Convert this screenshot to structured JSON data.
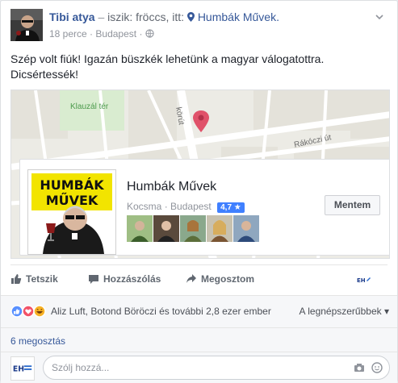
{
  "header": {
    "author": "Tibi atya",
    "dash": "–",
    "activity": "iszik: fröccs, itt:",
    "place": "Humbák Művek.",
    "time": "18 perce",
    "location": "Budapest",
    "sep": "·"
  },
  "post_text": "Szép volt fiúk! Igazán büszkék lehetünk a magyar válogatottra. Dicsértessék!",
  "map": {
    "labels": {
      "park": "Klauzál tér",
      "street1": "körút",
      "street2": "Rákóczi út"
    },
    "place_card": {
      "logo_line1": "HUMBÁK",
      "logo_line2": "MŰVEK",
      "name": "Humbák Művek",
      "category": "Kocsma",
      "city": "Budapest",
      "sep": "·",
      "rating": "4,7 ★",
      "button": "Mentem"
    }
  },
  "actions": {
    "like": "Tetszik",
    "comment": "Hozzászólás",
    "share": "Megosztom",
    "eh_label": "EH"
  },
  "reactions": {
    "text": "Aliz Luft, Botond Böröczi és további 2,8 ezer ember",
    "order": "A legnépszerűbbek",
    "colors": {
      "like": "#5890ff",
      "love": "#f25268",
      "haha": "#f7b125"
    }
  },
  "shares": "6 megosztás",
  "comment": {
    "placeholder": "Szólj hozzá...",
    "avatar_label": "EH"
  },
  "icons": [
    "chevron-down-icon",
    "pin-icon",
    "globe-icon",
    "like-icon",
    "comment-icon",
    "share-icon",
    "camera-icon",
    "sticker-icon"
  ]
}
